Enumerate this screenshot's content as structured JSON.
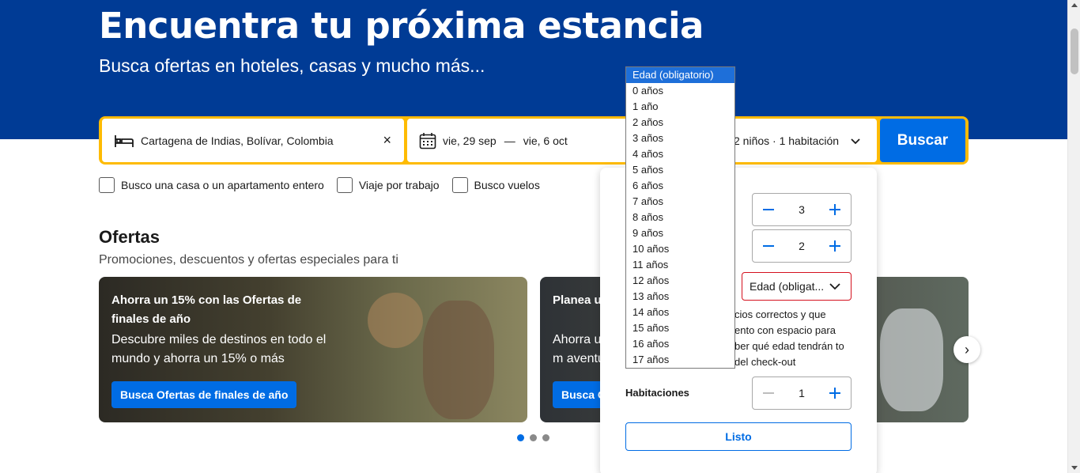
{
  "hero": {
    "title": "Encuentra tu próxima estancia",
    "subtitle": "Busca ofertas en hoteles, casas y mucho más..."
  },
  "search": {
    "destination": "Cartagena de Indias, Bolívar, Colombia",
    "clear_icon": "×",
    "checkin": "vie, 29 sep",
    "date_separator": "—",
    "checkout": "vie, 6 oct",
    "occupancy": "2 niños · 1 habitación",
    "button": "Buscar"
  },
  "checkboxes": [
    {
      "label": "Busco una casa o un apartamento entero"
    },
    {
      "label": "Viaje por trabajo"
    },
    {
      "label": "Busco vuelos"
    }
  ],
  "offers": {
    "title": "Ofertas",
    "subtitle": "Promociones, descuentos y ofertas especiales para ti",
    "cards": [
      {
        "title": "Ahorra un 15% con las Ofertas de finales de año",
        "text": "Descubre miles de destinos en todo el mundo y ahorra un 15% o más",
        "button": "Busca Ofertas de finales de año"
      },
      {
        "title": "Planea u",
        "text": "Ahorra u todo el m aventura",
        "button": "Busca O"
      }
    ],
    "carousel_next": "›",
    "carousel_dots": 3,
    "carousel_active_dot": 1
  },
  "occupancy_panel": {
    "adults_value": "3",
    "children_value": "2",
    "age_select_value": "Edad (obligat...",
    "note": "cios correctos y que ento con espacio para ber qué edad tendrán to del check-out",
    "rooms_label": "Habitaciones",
    "rooms_value": "1",
    "done_button": "Listo"
  },
  "age_dropdown": {
    "selected_index": 0,
    "options": [
      "Edad (obligatorio)",
      "0 años",
      "1 año",
      "2 años",
      "3 años",
      "4 años",
      "5 años",
      "6 años",
      "7 años",
      "8 años",
      "9 años",
      "10 años",
      "11 años",
      "12 años",
      "13 años",
      "14 años",
      "15 años",
      "16 años",
      "17 años"
    ]
  },
  "colors": {
    "brand_blue": "#003b95",
    "accent_blue": "#006ce4",
    "search_yellow": "#febb02",
    "error_red": "#d4111e"
  },
  "icons": {
    "bed": "bed-icon",
    "calendar": "calendar-icon",
    "clear": "close-icon",
    "chevron": "chevron-down-icon",
    "next": "chevron-right-icon"
  }
}
